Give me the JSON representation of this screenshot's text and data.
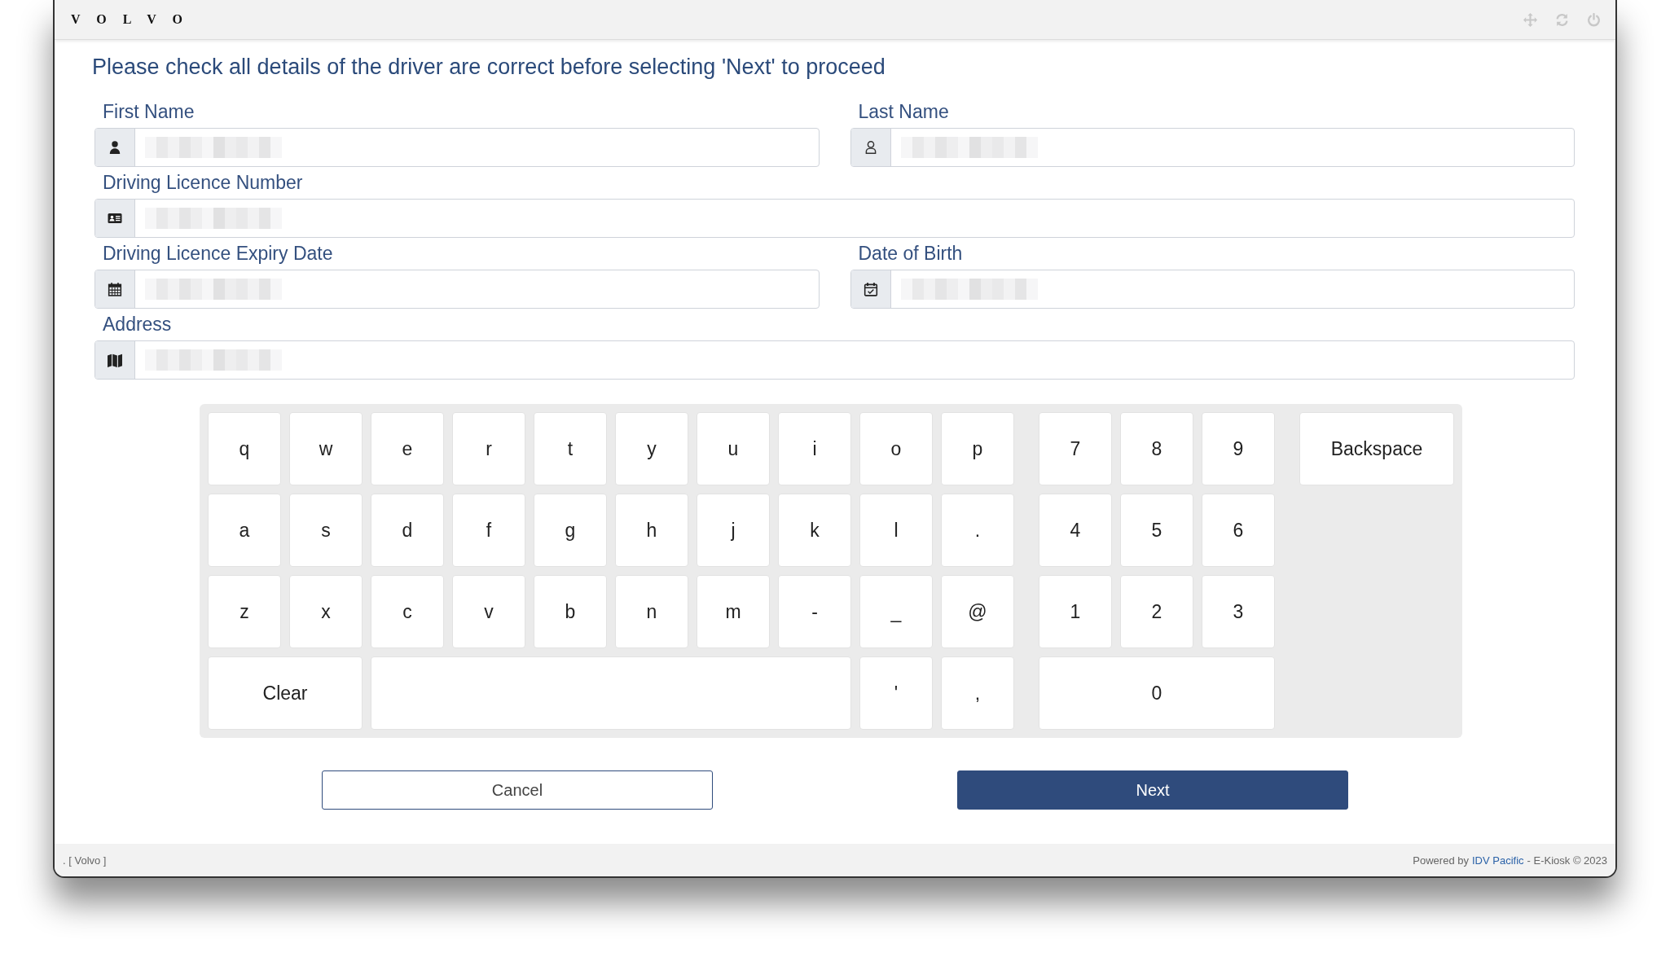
{
  "header": {
    "logo": "V O L V O"
  },
  "instruction": "Please check all details of the driver are correct before selecting 'Next' to proceed",
  "field_rows": [
    [
      {
        "label": "First Name",
        "redacted": true
      },
      {
        "label": "Last Name",
        "redacted": true
      }
    ],
    [
      {
        "label": "Driving Licence Number",
        "redacted": true
      }
    ],
    [
      {
        "label": "Driving Licence Expiry Date",
        "redacted": true
      },
      {
        "label": "Date of Birth",
        "redacted": true
      }
    ],
    [
      {
        "label": "Address",
        "redacted": true
      }
    ]
  ],
  "keyboard": {
    "letters": [
      [
        {
          "label": "q",
          "kind": "char"
        },
        {
          "label": "w",
          "kind": "char"
        },
        {
          "label": "e",
          "kind": "char"
        },
        {
          "label": "r",
          "kind": "char"
        },
        {
          "label": "t",
          "kind": "char"
        },
        {
          "label": "y",
          "kind": "char"
        },
        {
          "label": "u",
          "kind": "char"
        },
        {
          "label": "i",
          "kind": "char"
        },
        {
          "label": "o",
          "kind": "char"
        },
        {
          "label": "p",
          "kind": "char"
        }
      ],
      [
        {
          "label": "a",
          "kind": "char"
        },
        {
          "label": "s",
          "kind": "char"
        },
        {
          "label": "d",
          "kind": "char"
        },
        {
          "label": "f",
          "kind": "char"
        },
        {
          "label": "g",
          "kind": "char"
        },
        {
          "label": "h",
          "kind": "char"
        },
        {
          "label": "j",
          "kind": "char"
        },
        {
          "label": "k",
          "kind": "char"
        },
        {
          "label": "l",
          "kind": "char"
        },
        {
          "label": ".",
          "kind": "char"
        }
      ],
      [
        {
          "label": "z",
          "kind": "char"
        },
        {
          "label": "x",
          "kind": "char"
        },
        {
          "label": "c",
          "kind": "char"
        },
        {
          "label": "v",
          "kind": "char"
        },
        {
          "label": "b",
          "kind": "char"
        },
        {
          "label": "n",
          "kind": "char"
        },
        {
          "label": "m",
          "kind": "char"
        },
        {
          "label": "-",
          "kind": "char"
        },
        {
          "label": "_",
          "kind": "char"
        },
        {
          "label": "@",
          "kind": "char"
        }
      ],
      [
        {
          "label": "Clear",
          "kind": "double"
        },
        {
          "kind": "space"
        },
        {
          "label": "'",
          "kind": "char"
        },
        {
          "label": ",",
          "kind": "char"
        }
      ]
    ],
    "numbers": [
      [
        {
          "label": "7",
          "kind": "char"
        },
        {
          "label": "8",
          "kind": "char"
        },
        {
          "label": "9",
          "kind": "char"
        }
      ],
      [
        {
          "label": "4",
          "kind": "char"
        },
        {
          "label": "5",
          "kind": "char"
        },
        {
          "label": "6",
          "kind": "char"
        }
      ],
      [
        {
          "label": "1",
          "kind": "char"
        },
        {
          "label": "2",
          "kind": "char"
        },
        {
          "label": "3",
          "kind": "char"
        }
      ],
      [
        {
          "label": "0",
          "kind": "triple"
        }
      ]
    ],
    "backspace": "Backspace"
  },
  "buttons": {
    "cancel": "Cancel",
    "next": "Next"
  },
  "footer": {
    "left": ". [ Volvo ]",
    "powered": "Powered by",
    "link": "IDV Pacific",
    "rest": "- E-Kiosk © 2023"
  }
}
